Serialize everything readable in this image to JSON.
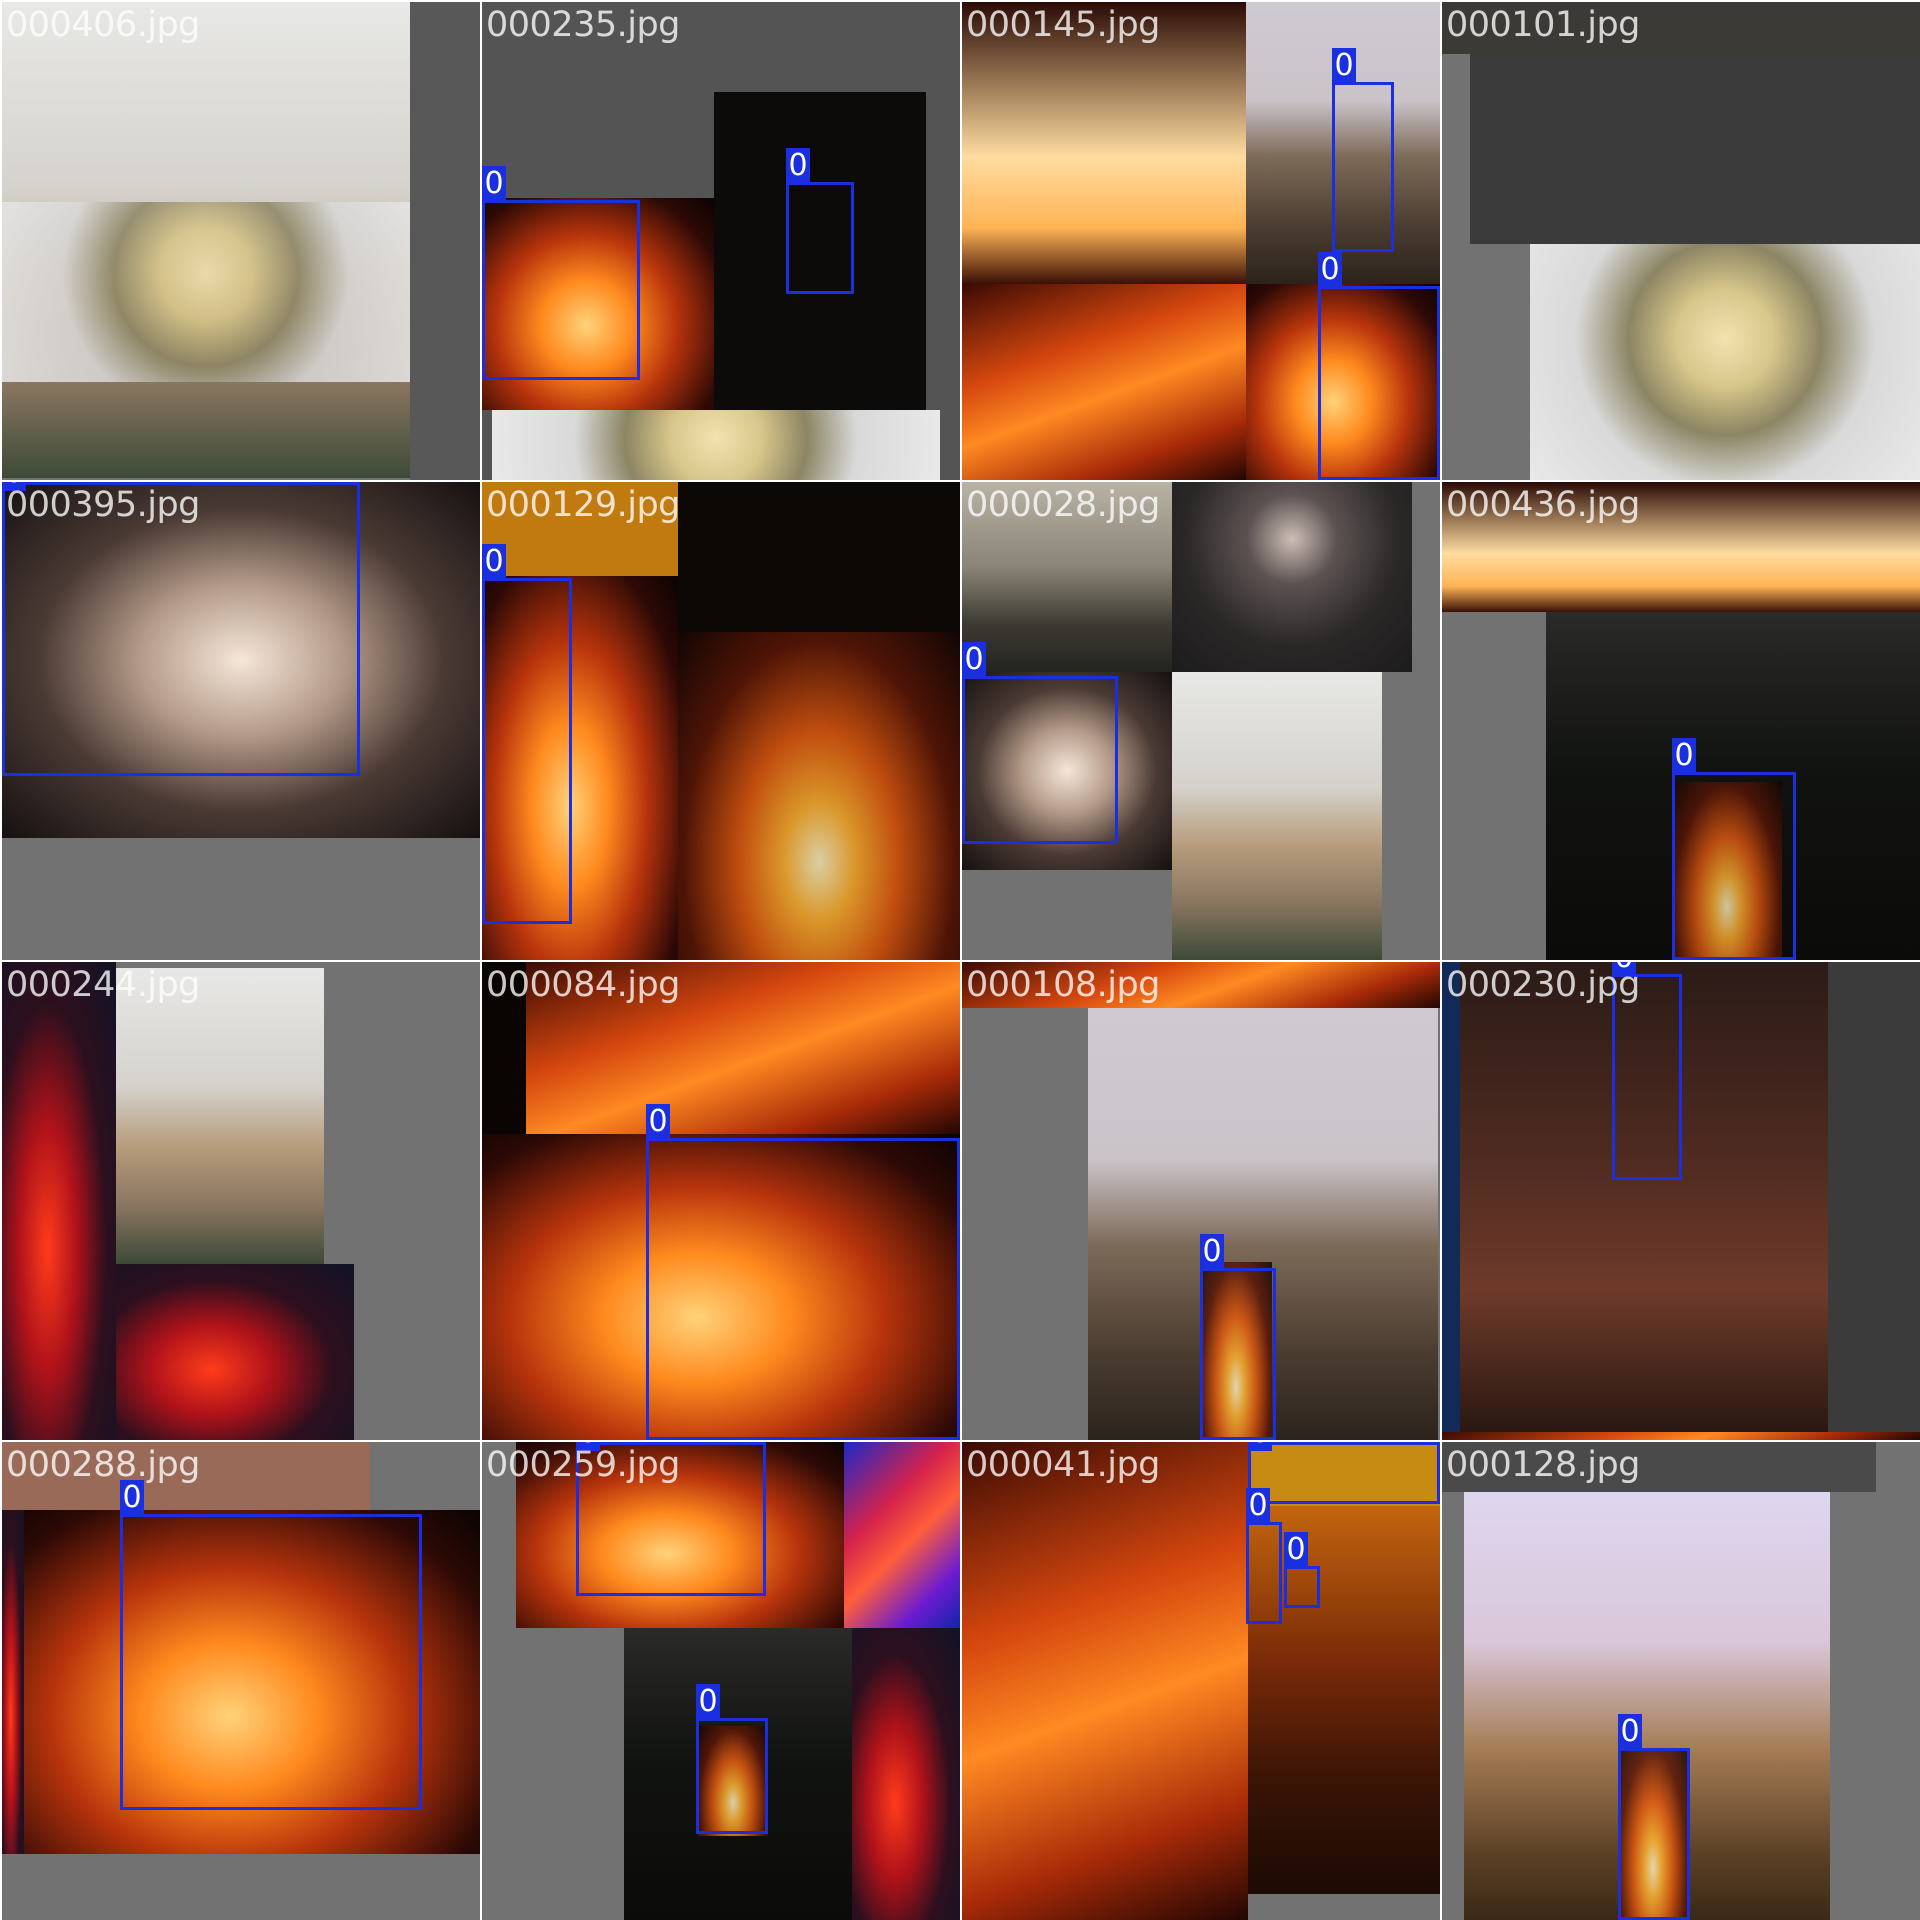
{
  "mosaic": {
    "tiles": [
      {
        "label": "000406.jpg"
      },
      {
        "label": "000235.jpg"
      },
      {
        "label": "000145.jpg"
      },
      {
        "label": "000101.jpg"
      },
      {
        "label": "000395.jpg"
      },
      {
        "label": "000129.jpg"
      },
      {
        "label": "000028.jpg"
      },
      {
        "label": "000436.jpg"
      },
      {
        "label": "000244.jpg"
      },
      {
        "label": "000084.jpg"
      },
      {
        "label": "000108.jpg"
      },
      {
        "label": "000230.jpg"
      },
      {
        "label": "000288.jpg"
      },
      {
        "label": "000259.jpg"
      },
      {
        "label": "000041.jpg"
      },
      {
        "label": "000128.jpg"
      }
    ],
    "box_class_label": "0",
    "box_color": "#1a2fe0"
  }
}
